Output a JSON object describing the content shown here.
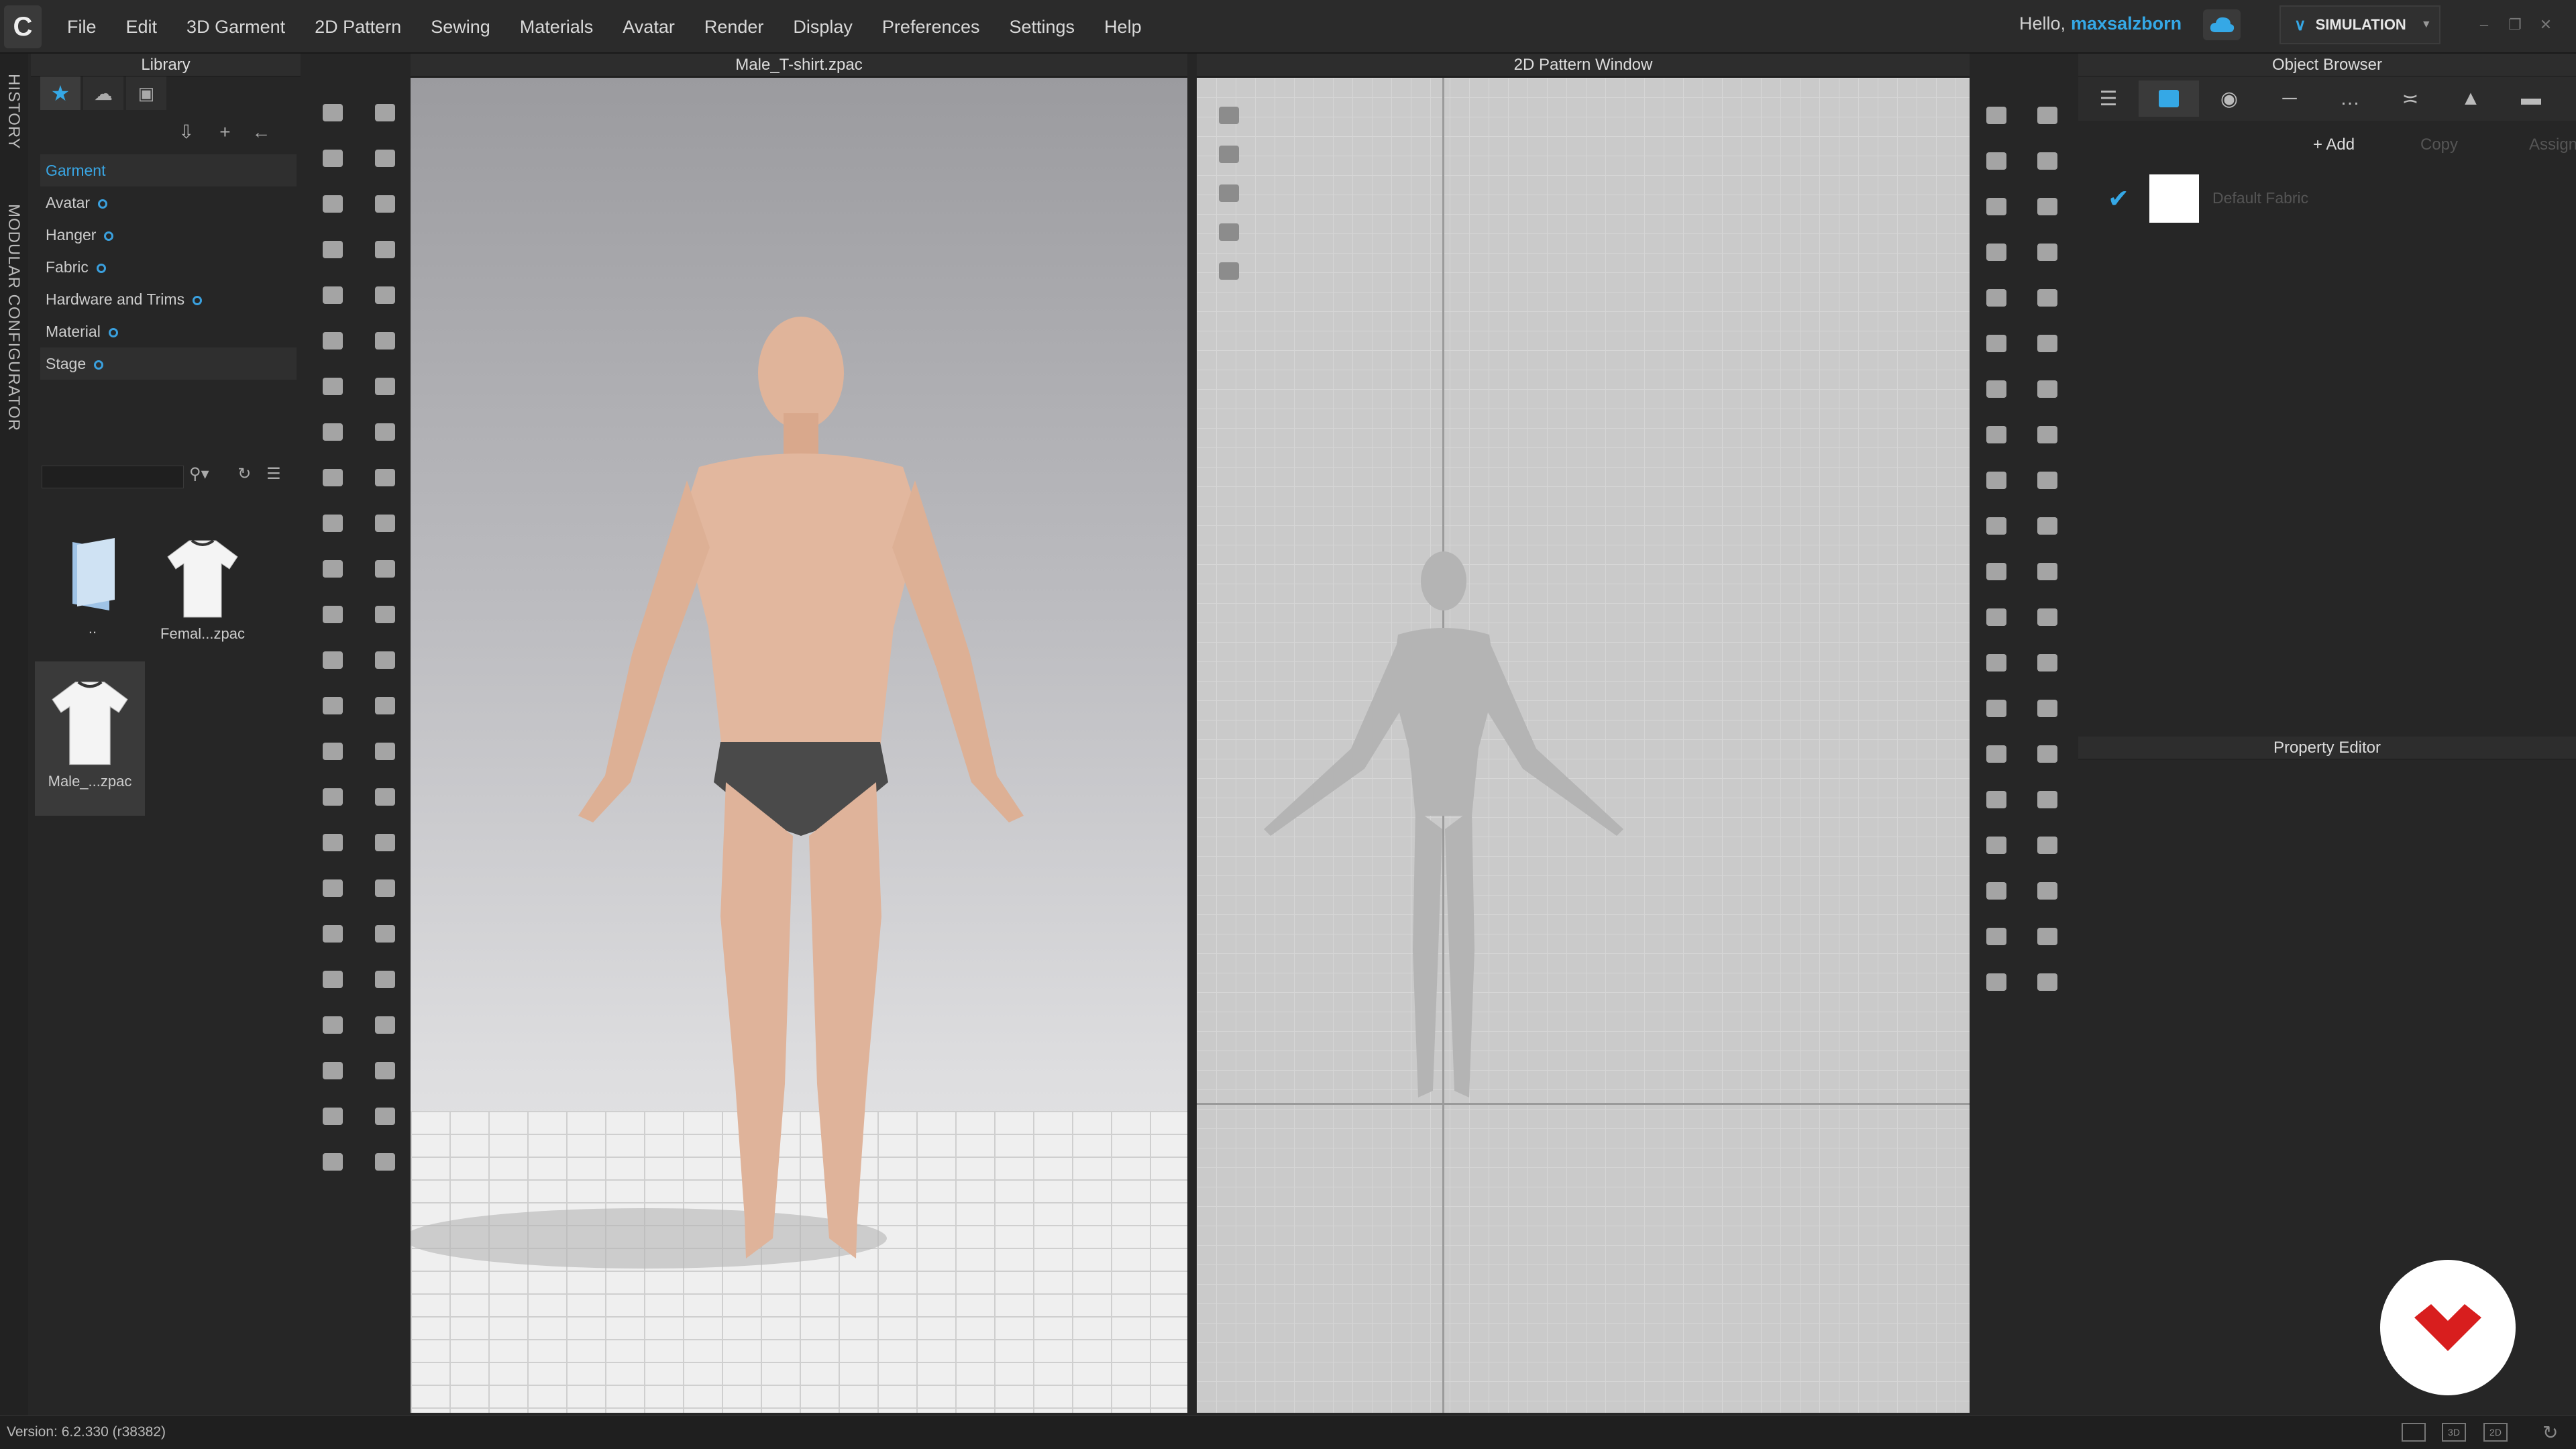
{
  "menubar": {
    "items": [
      "File",
      "Edit",
      "3D Garment",
      "2D Pattern",
      "Sewing",
      "Materials",
      "Avatar",
      "Render",
      "Display",
      "Preferences",
      "Settings",
      "Help"
    ],
    "greeting": "Hello,",
    "username": "maxsalzborn",
    "mode": "SIMULATION"
  },
  "side_tabs": {
    "history": "HISTORY",
    "modular": "MODULAR CONFIGURATOR"
  },
  "library": {
    "title": "Library",
    "tree": [
      "Garment",
      "Avatar",
      "Hanger",
      "Fabric",
      "Hardware and Trims",
      "Material",
      "Stage"
    ],
    "search_placeholder": "",
    "thumbnails": [
      {
        "label": ".."
      },
      {
        "label": "Femal...zpac"
      },
      {
        "label": "Male_...zpac"
      }
    ]
  },
  "viewport3d": {
    "title": "Male_T-shirt.zpac"
  },
  "pattern2d": {
    "title": "2D Pattern Window"
  },
  "object_browser": {
    "title": "Object Browser",
    "add_label": "+ Add",
    "copy_label": "Copy",
    "assign_label": "Assign",
    "fabric_name": "Default Fabric"
  },
  "property_editor": {
    "title": "Property Editor"
  },
  "status": {
    "version": "Version: 6.2.330 (r38382)"
  },
  "colors": {
    "accent": "#35a8e6",
    "brand_badge": "#d81e1e"
  }
}
